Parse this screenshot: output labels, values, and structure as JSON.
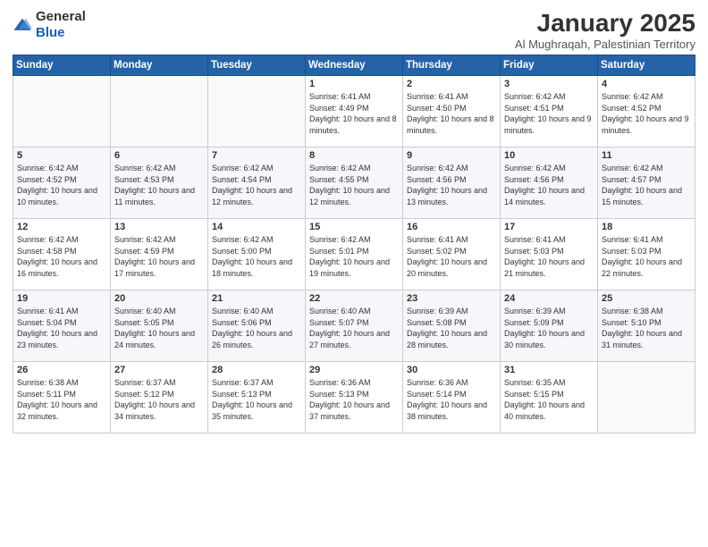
{
  "header": {
    "logo_general": "General",
    "logo_blue": "Blue",
    "title": "January 2025",
    "subtitle": "Al Mughraqah, Palestinian Territory"
  },
  "days_of_week": [
    "Sunday",
    "Monday",
    "Tuesday",
    "Wednesday",
    "Thursday",
    "Friday",
    "Saturday"
  ],
  "weeks": [
    [
      {
        "day": "",
        "info": ""
      },
      {
        "day": "",
        "info": ""
      },
      {
        "day": "",
        "info": ""
      },
      {
        "day": "1",
        "info": "Sunrise: 6:41 AM\nSunset: 4:49 PM\nDaylight: 10 hours\nand 8 minutes."
      },
      {
        "day": "2",
        "info": "Sunrise: 6:41 AM\nSunset: 4:50 PM\nDaylight: 10 hours\nand 8 minutes."
      },
      {
        "day": "3",
        "info": "Sunrise: 6:42 AM\nSunset: 4:51 PM\nDaylight: 10 hours\nand 9 minutes."
      },
      {
        "day": "4",
        "info": "Sunrise: 6:42 AM\nSunset: 4:52 PM\nDaylight: 10 hours\nand 9 minutes."
      }
    ],
    [
      {
        "day": "5",
        "info": "Sunrise: 6:42 AM\nSunset: 4:52 PM\nDaylight: 10 hours\nand 10 minutes."
      },
      {
        "day": "6",
        "info": "Sunrise: 6:42 AM\nSunset: 4:53 PM\nDaylight: 10 hours\nand 11 minutes."
      },
      {
        "day": "7",
        "info": "Sunrise: 6:42 AM\nSunset: 4:54 PM\nDaylight: 10 hours\nand 12 minutes."
      },
      {
        "day": "8",
        "info": "Sunrise: 6:42 AM\nSunset: 4:55 PM\nDaylight: 10 hours\nand 12 minutes."
      },
      {
        "day": "9",
        "info": "Sunrise: 6:42 AM\nSunset: 4:56 PM\nDaylight: 10 hours\nand 13 minutes."
      },
      {
        "day": "10",
        "info": "Sunrise: 6:42 AM\nSunset: 4:56 PM\nDaylight: 10 hours\nand 14 minutes."
      },
      {
        "day": "11",
        "info": "Sunrise: 6:42 AM\nSunset: 4:57 PM\nDaylight: 10 hours\nand 15 minutes."
      }
    ],
    [
      {
        "day": "12",
        "info": "Sunrise: 6:42 AM\nSunset: 4:58 PM\nDaylight: 10 hours\nand 16 minutes."
      },
      {
        "day": "13",
        "info": "Sunrise: 6:42 AM\nSunset: 4:59 PM\nDaylight: 10 hours\nand 17 minutes."
      },
      {
        "day": "14",
        "info": "Sunrise: 6:42 AM\nSunset: 5:00 PM\nDaylight: 10 hours\nand 18 minutes."
      },
      {
        "day": "15",
        "info": "Sunrise: 6:42 AM\nSunset: 5:01 PM\nDaylight: 10 hours\nand 19 minutes."
      },
      {
        "day": "16",
        "info": "Sunrise: 6:41 AM\nSunset: 5:02 PM\nDaylight: 10 hours\nand 20 minutes."
      },
      {
        "day": "17",
        "info": "Sunrise: 6:41 AM\nSunset: 5:03 PM\nDaylight: 10 hours\nand 21 minutes."
      },
      {
        "day": "18",
        "info": "Sunrise: 6:41 AM\nSunset: 5:03 PM\nDaylight: 10 hours\nand 22 minutes."
      }
    ],
    [
      {
        "day": "19",
        "info": "Sunrise: 6:41 AM\nSunset: 5:04 PM\nDaylight: 10 hours\nand 23 minutes."
      },
      {
        "day": "20",
        "info": "Sunrise: 6:40 AM\nSunset: 5:05 PM\nDaylight: 10 hours\nand 24 minutes."
      },
      {
        "day": "21",
        "info": "Sunrise: 6:40 AM\nSunset: 5:06 PM\nDaylight: 10 hours\nand 26 minutes."
      },
      {
        "day": "22",
        "info": "Sunrise: 6:40 AM\nSunset: 5:07 PM\nDaylight: 10 hours\nand 27 minutes."
      },
      {
        "day": "23",
        "info": "Sunrise: 6:39 AM\nSunset: 5:08 PM\nDaylight: 10 hours\nand 28 minutes."
      },
      {
        "day": "24",
        "info": "Sunrise: 6:39 AM\nSunset: 5:09 PM\nDaylight: 10 hours\nand 30 minutes."
      },
      {
        "day": "25",
        "info": "Sunrise: 6:38 AM\nSunset: 5:10 PM\nDaylight: 10 hours\nand 31 minutes."
      }
    ],
    [
      {
        "day": "26",
        "info": "Sunrise: 6:38 AM\nSunset: 5:11 PM\nDaylight: 10 hours\nand 32 minutes."
      },
      {
        "day": "27",
        "info": "Sunrise: 6:37 AM\nSunset: 5:12 PM\nDaylight: 10 hours\nand 34 minutes."
      },
      {
        "day": "28",
        "info": "Sunrise: 6:37 AM\nSunset: 5:13 PM\nDaylight: 10 hours\nand 35 minutes."
      },
      {
        "day": "29",
        "info": "Sunrise: 6:36 AM\nSunset: 5:13 PM\nDaylight: 10 hours\nand 37 minutes."
      },
      {
        "day": "30",
        "info": "Sunrise: 6:36 AM\nSunset: 5:14 PM\nDaylight: 10 hours\nand 38 minutes."
      },
      {
        "day": "31",
        "info": "Sunrise: 6:35 AM\nSunset: 5:15 PM\nDaylight: 10 hours\nand 40 minutes."
      },
      {
        "day": "",
        "info": ""
      }
    ]
  ]
}
